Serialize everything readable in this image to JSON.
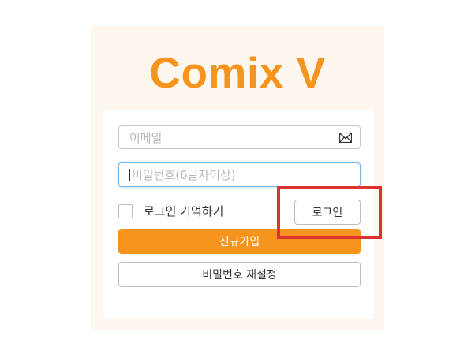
{
  "brand": {
    "logo_text": "Comix V",
    "accent_color": "#f7941d"
  },
  "form": {
    "email": {
      "placeholder": "이메일",
      "value": "",
      "icon": "mail-icon"
    },
    "password": {
      "placeholder": "비밀번호(6글자이상)",
      "value": "",
      "focused": true
    },
    "remember": {
      "label": "로그인 기억하기",
      "checked": false
    },
    "login_button": "로그인",
    "signup_button": "신규가입",
    "reset_button": "비밀번호 재설정"
  },
  "annotation": {
    "highlight_color": "#e03131",
    "target": "login-button"
  }
}
